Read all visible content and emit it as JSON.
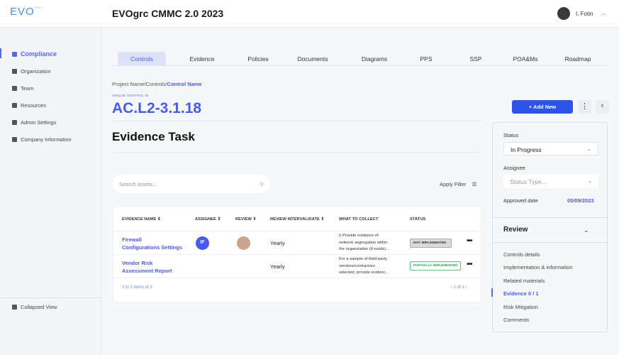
{
  "header": {
    "logo": "EVO",
    "logo_sup": "GRC",
    "title": "EVOgrc CMMC 2.0 2023",
    "user": "I. Fotin"
  },
  "sidebar": {
    "items": [
      {
        "label": "Compliance",
        "icon": "compliance-icon"
      },
      {
        "label": "Organization",
        "icon": "building-icon"
      },
      {
        "label": "Team",
        "icon": "team-icon"
      },
      {
        "label": "Resources",
        "icon": "file-icon"
      },
      {
        "label": "Admin Settings",
        "icon": "user-icon"
      },
      {
        "label": "Company Information",
        "icon": "briefcase-icon"
      }
    ],
    "collapse": "Collapsed View"
  },
  "tabs": [
    "Controls",
    "Evidence",
    "Policies",
    "Documents",
    "Diagrams",
    "PPS",
    "SSP",
    "POA&Ms",
    "Roadmap"
  ],
  "breadcrumb": {
    "path": "Project Name/Controls/",
    "current": "Control Name"
  },
  "control": {
    "label": "UNIQUE CONTROL ID",
    "id": "AC.L2-3.1.18"
  },
  "page_title": "Evidence Task",
  "search": {
    "placeholder": "Search assets..."
  },
  "apply_filter": "Apply Filter",
  "table": {
    "headers": [
      "EVIDENCE NAME ⇕",
      "ASSIGNEE ⇕",
      "REVIEW ⇕",
      "REVIEW INTERVAL/DATE ⇕",
      "WHAT TO COLLECT",
      "STATUS"
    ],
    "rows": [
      {
        "name1": "Firewall",
        "name2": "Configurations Settings",
        "assignee": "IF",
        "interval": "Yearly",
        "collect": [
          "i) Provide evidence of",
          "network segregation within",
          "the organization (if exists)..."
        ],
        "status": "NOT IMPLEMENTED"
      },
      {
        "name1": "Vendor Risk",
        "name2": "Assessment Report",
        "assignee": "",
        "interval": "Yearly",
        "collect": [
          "For a sample of third-party",
          "vendors/contractors",
          "selected, provide evidenc..."
        ],
        "status": "PARTIALLY IMPLEMENTED"
      }
    ],
    "footer": "2 to 2 items of 2",
    "pagination": "1 of 1"
  },
  "actions": {
    "add_new": "+ Add New"
  },
  "panel": {
    "status_label": "Status",
    "status_value": "In Progress",
    "assignee_label": "Assignee",
    "assignee_placeholder": "Status Type...",
    "approved_label": "Approved date",
    "approved_value": "05/09/2023",
    "review": "Review",
    "nav": [
      "Controls details",
      "Implementation & information",
      "Related materials",
      "Evidence 0 / 1",
      "Risk Mitigation",
      "Comments"
    ]
  },
  "colors": {
    "accent": "#5468ff",
    "button": "#2b53e8"
  }
}
